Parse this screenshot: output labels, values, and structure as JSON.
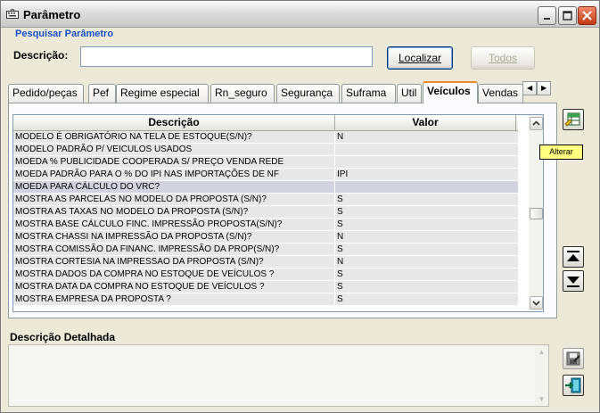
{
  "window": {
    "title": "Parâmetro"
  },
  "search": {
    "legend": "Pesquisar Parâmetro",
    "description_label": "Descrição:",
    "description_value": "",
    "find_button": "Localizar",
    "all_button": "Todos"
  },
  "tabs": [
    {
      "label": "Pedido/peças",
      "active": false
    },
    {
      "label": "Pef",
      "active": false
    },
    {
      "label": "Regime especial",
      "active": false
    },
    {
      "label": "Rn_seguro",
      "active": false
    },
    {
      "label": "Segurança",
      "active": false
    },
    {
      "label": "Suframa",
      "active": false
    },
    {
      "label": "Util",
      "active": false
    },
    {
      "label": "Veículos",
      "active": true
    },
    {
      "label": "Vendas",
      "active": false
    }
  ],
  "grid": {
    "columns": [
      "Descrição",
      "Valor"
    ],
    "rows": [
      {
        "description": "MODELO É OBRIGATÓRIO NA TELA DE ESTOQUE(S/N)?",
        "value": "N"
      },
      {
        "description": "MODELO PADRÃO P/ VEICULOS USADOS",
        "value": ""
      },
      {
        "description": "MOEDA % PUBLICIDADE COOPERADA S/ PREÇO VENDA REDE",
        "value": ""
      },
      {
        "description": "MOEDA PADRÃO PARA O % DO IPI NAS IMPORTAÇÕES DE NF",
        "value": "IPI"
      },
      {
        "description": "MOEDA PARA CÁLCULO DO VRC?",
        "value": ""
      },
      {
        "description": "MOSTRA AS PARCELAS NO MODELO DA PROPOSTA (S/N)?",
        "value": "S"
      },
      {
        "description": "MOSTRA AS TAXAS NO MODELO DA PROPOSTA (S/N)?",
        "value": "S"
      },
      {
        "description": "MOSTRA BASE CÁLCULO FINC. IMPRESSÃO PROPOSTA(S/N)?",
        "value": "S"
      },
      {
        "description": "MOSTRA CHASSI NA IMPRESSÃO DA PROPOSTA (S/N)?",
        "value": "N"
      },
      {
        "description": "MOSTRA COMISSÃO DA FINANC. IMPRESSÃO DA PROP(S/N)?",
        "value": "S"
      },
      {
        "description": "MOSTRA CORTESIA NA IMPRESSAO DA PROPOSTA (S/N)?",
        "value": "N"
      },
      {
        "description": "MOSTRA DADOS DA COMPRA NO ESTOQUE DE VEÍCULOS ?",
        "value": "S"
      },
      {
        "description": "MOSTRA DATA DA COMPRA NO ESTOQUE DE VEÍCULOS ?",
        "value": "S"
      },
      {
        "description": "MOSTRA EMPRESA DA PROPOSTA ?",
        "value": "S"
      }
    ],
    "selected_row": 4
  },
  "side_tools": {
    "edit_icon": "grid-edit-icon",
    "tooltip": "Alterar",
    "move_up_icon": "move-up-icon",
    "move_down_icon": "move-down-icon",
    "save_icon": "save-icon",
    "exit_icon": "exit-icon"
  },
  "detail": {
    "label": "Descrição Detalhada",
    "text": ""
  },
  "colors": {
    "legend_blue": "#1a4fc8",
    "tab_highlight": "#e68b2c",
    "tooltip_bg": "#ffff80",
    "row_bg": "#e7e7e7",
    "row_selected": "#d3d3df"
  }
}
